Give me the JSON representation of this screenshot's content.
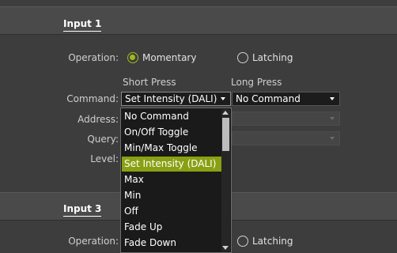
{
  "input1": {
    "title": "Input 1",
    "operation_label": "Operation:",
    "momentary_label": "Momentary",
    "latching_label": "Latching",
    "short_press_header": "Short Press",
    "long_press_header": "Long Press",
    "command_label": "Command:",
    "command_short_value": "Set Intensity (DALI)",
    "command_long_value": "No Command",
    "address_label": "Address:",
    "query_label": "Query:",
    "level_label": "Level:"
  },
  "input3": {
    "title": "Input 3",
    "operation_label": "Operation:",
    "latching_label": "Latching"
  },
  "dropdown": {
    "items": [
      "No Command",
      "On/Off Toggle",
      "Min/Max Toggle",
      "Set Intensity (DALI)",
      "Max",
      "Min",
      "Off",
      "Fade Up",
      "Fade Down"
    ],
    "selected": "Set Intensity (DALI)"
  },
  "colors": {
    "accent": "#8aa014",
    "background": "#3d3d3d",
    "header": "#4a4a4a"
  }
}
